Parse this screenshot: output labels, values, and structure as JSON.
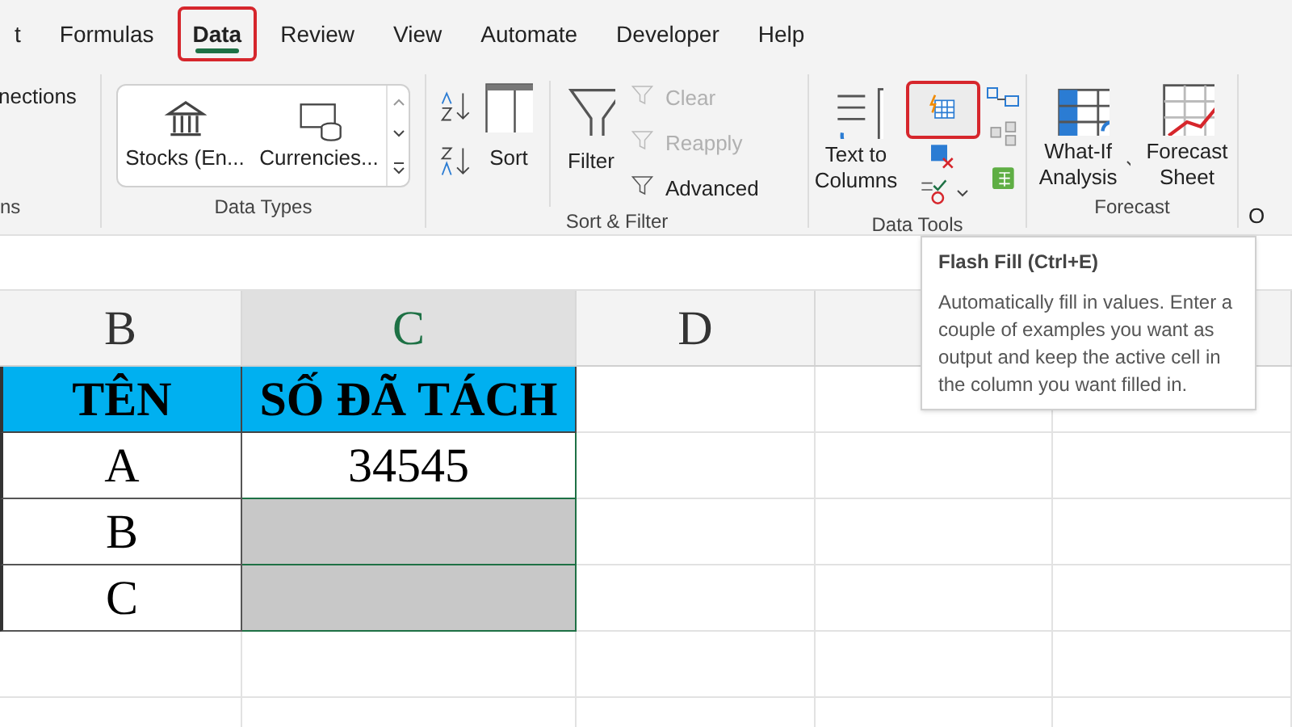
{
  "tabs": [
    {
      "label": "t",
      "selected": false,
      "highlighted": false
    },
    {
      "label": "Formulas",
      "selected": false,
      "highlighted": false
    },
    {
      "label": "Data",
      "selected": true,
      "highlighted": true
    },
    {
      "label": "Review",
      "selected": false,
      "highlighted": false
    },
    {
      "label": "View",
      "selected": false,
      "highlighted": false
    },
    {
      "label": "Automate",
      "selected": false,
      "highlighted": false
    },
    {
      "label": "Developer",
      "selected": false,
      "highlighted": false
    },
    {
      "label": "Help",
      "selected": false,
      "highlighted": false
    }
  ],
  "ribbon": {
    "connections": {
      "item": "nections",
      "label": "ns"
    },
    "data_types": {
      "items": [
        "Stocks (En...",
        "Currencies..."
      ],
      "label": "Data Types"
    },
    "sort_filter": {
      "sort": "Sort",
      "filter": "Filter",
      "items": [
        {
          "label": "Clear",
          "disabled": true
        },
        {
          "label": "Reapply",
          "disabled": true
        },
        {
          "label": "Advanced",
          "disabled": false
        }
      ],
      "label": "Sort & Filter"
    },
    "data_tools": {
      "text_to_columns": "Text to Columns",
      "flash_fill_highlighted": true,
      "label": "Data Tools"
    },
    "forecast": {
      "what_if": "What-If Analysis",
      "forecast_sheet": "Forecast Sheet",
      "label": "Forecast"
    },
    "partial": "O"
  },
  "tooltip": {
    "title": "Flash Fill (Ctrl+E)",
    "body": "Automatically fill in values. Enter a couple of examples you want as output and keep the active cell in the column you want filled in."
  },
  "sheet": {
    "columns": [
      {
        "label": "B",
        "selected": false
      },
      {
        "label": "C",
        "selected": true
      },
      {
        "label": "D",
        "selected": false
      }
    ],
    "rows": [
      [
        {
          "text": "TÊN",
          "kind": "header"
        },
        {
          "text": "SỐ ĐÃ TÁCH",
          "kind": "header"
        }
      ],
      [
        {
          "text": "A",
          "kind": "value",
          "selected": false
        },
        {
          "text": "34545",
          "kind": "value",
          "selected": false
        }
      ],
      [
        {
          "text": "B",
          "kind": "value",
          "selected": false
        },
        {
          "kind": "value",
          "selected": true
        }
      ],
      [
        {
          "text": "C",
          "kind": "value",
          "selected": false
        },
        {
          "kind": "value",
          "selected": true
        }
      ]
    ]
  }
}
